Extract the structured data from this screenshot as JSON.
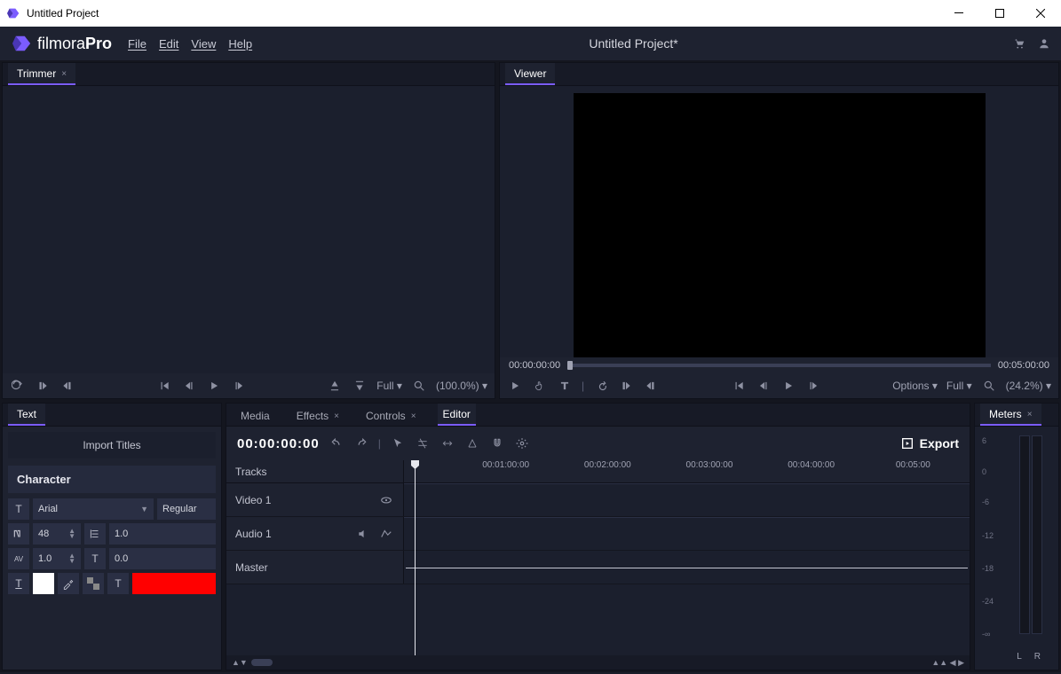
{
  "window": {
    "title": "Untitled Project"
  },
  "app": {
    "name_a": "filmora",
    "name_b": "Pro"
  },
  "menu": {
    "file": "File",
    "edit": "Edit",
    "view": "View",
    "help": "Help"
  },
  "project": {
    "title": "Untitled Project*"
  },
  "trimmer": {
    "tab": "Trimmer",
    "res": "Full",
    "zoom": "(100.0%)"
  },
  "viewer": {
    "tab": "Viewer",
    "time_start": "00:00:00:00",
    "time_end": "00:05:00:00",
    "options": "Options",
    "res": "Full",
    "zoom": "(24.2%)"
  },
  "textpanel": {
    "tab": "Text",
    "import": "Import Titles",
    "character": "Character",
    "font": "Arial",
    "weight": "Regular",
    "size": "48",
    "leading": "1.0",
    "tracking": "1.0",
    "baseline": "0.0"
  },
  "editor": {
    "tabs": {
      "media": "Media",
      "effects": "Effects",
      "controls": "Controls",
      "editor": "Editor"
    },
    "timecode": "00:00:00:00",
    "export": "Export",
    "tracks_label": "Tracks",
    "video1": "Video 1",
    "audio1": "Audio 1",
    "master": "Master",
    "ticks": [
      "00:01:00:00",
      "00:02:00:00",
      "00:03:00:00",
      "00:04:00:00",
      "00:05:00"
    ]
  },
  "meters": {
    "tab": "Meters",
    "levels": [
      "6",
      "0",
      "-6",
      "-12",
      "-18",
      "-24",
      "-∞"
    ],
    "L": "L",
    "R": "R"
  }
}
